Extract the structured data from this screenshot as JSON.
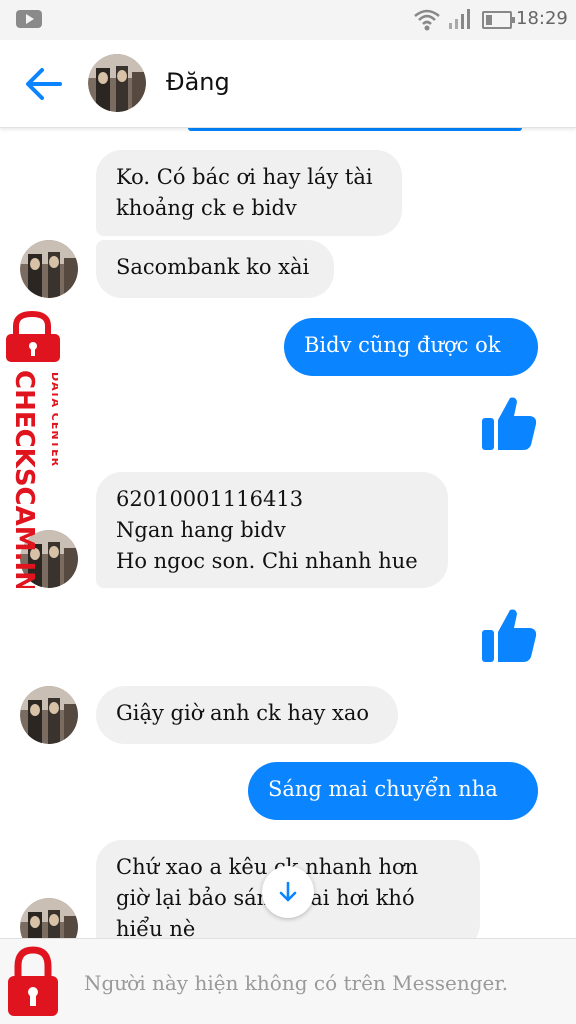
{
  "status_bar": {
    "time": "18:29",
    "icons": [
      "youtube-icon",
      "wifi-icon",
      "signal-icon",
      "battery-icon"
    ]
  },
  "header": {
    "contact_name": "Đăng",
    "back_icon": "arrow-left-icon",
    "accent": "#0084ff"
  },
  "messages": [
    {
      "direction": "incoming",
      "text": "Ko. Có bác ơi hay láy tài\nkhoảng ck e bidv"
    },
    {
      "direction": "incoming",
      "text": "Sacombank ko xài"
    },
    {
      "direction": "outgoing",
      "text": "Bidv cũng  được ok"
    },
    {
      "direction": "outgoing",
      "type": "like",
      "icon": "thumbs-up-icon"
    },
    {
      "direction": "incoming",
      "text": "62010001116413\nNgan hang bidv\nHo ngoc son. Chi nhanh hue"
    },
    {
      "direction": "outgoing",
      "type": "like",
      "icon": "thumbs-up-icon"
    },
    {
      "direction": "incoming",
      "text": "Giậy giờ anh ck hay xao"
    },
    {
      "direction": "outgoing",
      "text": "Sáng  mai chuyển  nha"
    },
    {
      "direction": "incoming",
      "text": "Chứ xao a kêu  ck nhanh hơn\ngiờ lại bảo sáng mai hơi khó\nhiểu nè"
    }
  ],
  "scroll_button_icon": "arrow-down-icon",
  "footer": {
    "status_text": "Người này hiện không có trên Messenger."
  },
  "watermark": {
    "data_center": "DATA CENTER",
    "brand": "CHECKSCAM.INFO",
    "icon": "padlock-icon",
    "color": "#e0141e"
  },
  "colors": {
    "outgoing_bubble": "#0a84ff",
    "incoming_bubble": "#f0f0f0"
  }
}
